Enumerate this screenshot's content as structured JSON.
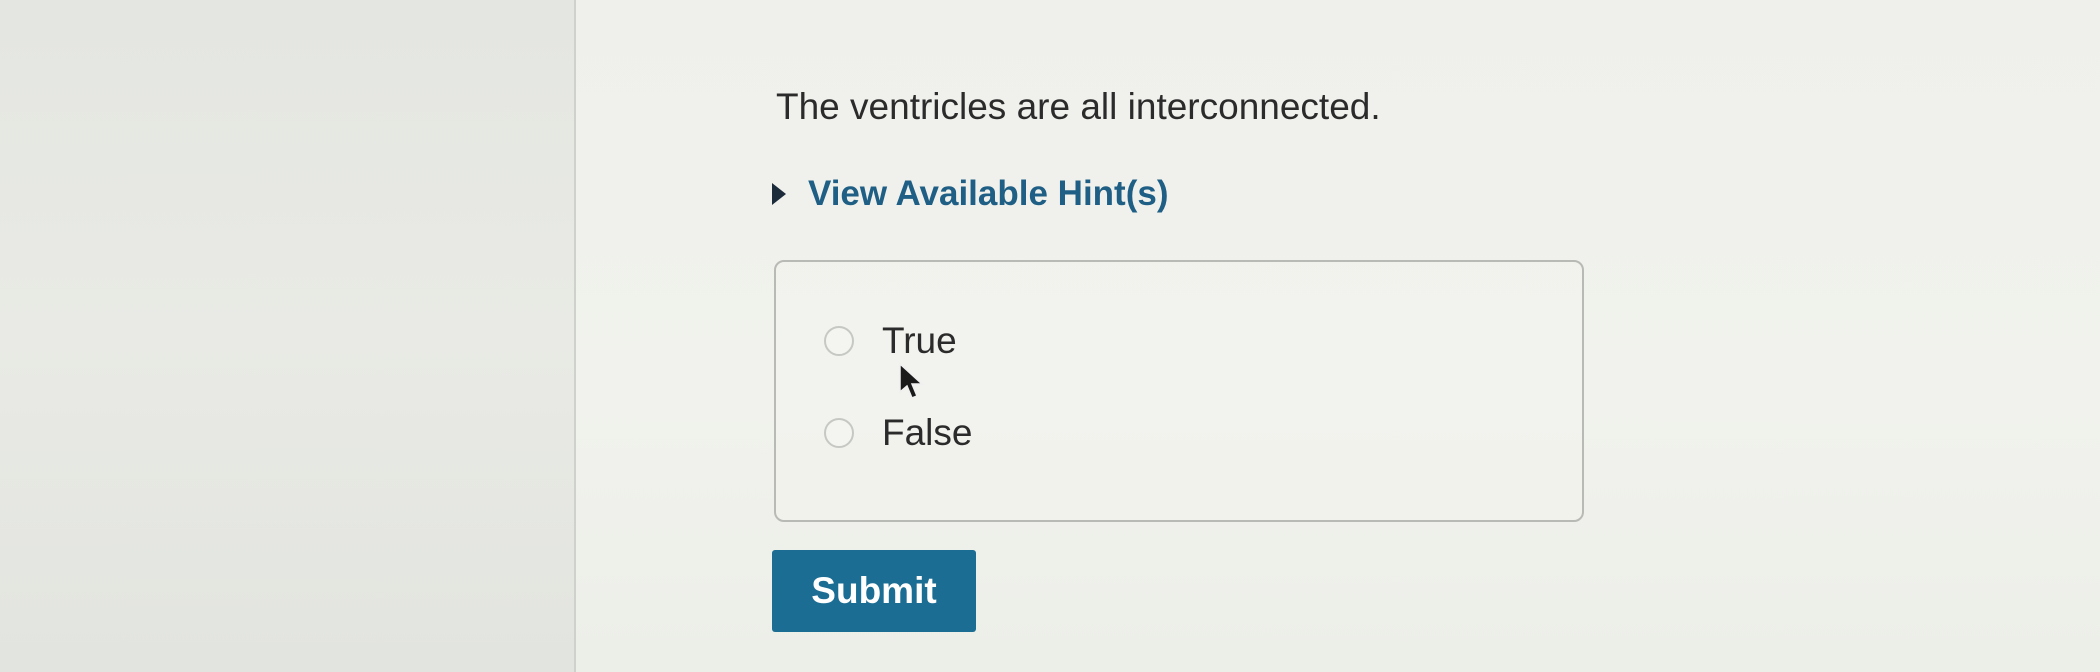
{
  "question": {
    "text": "The ventricles are all interconnected."
  },
  "hint": {
    "label": "View Available Hint(s)",
    "icon": "caret-right-icon"
  },
  "options": [
    {
      "label": "True",
      "selected": false
    },
    {
      "label": "False",
      "selected": false
    }
  ],
  "submit": {
    "label": "Submit"
  },
  "colors": {
    "accent": "#1c6d93",
    "hint_text": "#1f5f85",
    "body_text": "#2b2b2b"
  }
}
